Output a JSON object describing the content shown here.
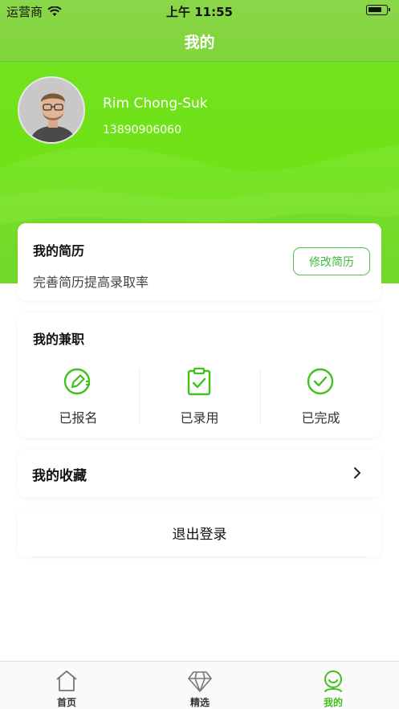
{
  "status_bar": {
    "carrier": "运营商",
    "time": "上午 11:55"
  },
  "nav": {
    "title": "我的"
  },
  "profile": {
    "name": "Rim Chong-Suk",
    "phone": "13890906060"
  },
  "resume_card": {
    "title": "我的简历",
    "subtitle": "完善简历提高录取率",
    "edit_label": "修改简历"
  },
  "jobs_card": {
    "title": "我的兼职",
    "items": [
      {
        "label": "已报名",
        "icon": "sign-up-pencil-icon"
      },
      {
        "label": "已录用",
        "icon": "clipboard-check-icon"
      },
      {
        "label": "已完成",
        "icon": "check-circle-icon"
      }
    ]
  },
  "favorites": {
    "label": "我的收藏"
  },
  "logout": {
    "label": "退出登录"
  },
  "tabbar": {
    "items": [
      {
        "label": "首页",
        "icon": "home-icon",
        "active": false
      },
      {
        "label": "精选",
        "icon": "diamond-icon",
        "active": false
      },
      {
        "label": "我的",
        "icon": "profile-face-icon",
        "active": true
      }
    ]
  },
  "colors": {
    "accent": "#3ec21c",
    "header_green": "#6fe316",
    "button_green": "#4cc24a"
  }
}
